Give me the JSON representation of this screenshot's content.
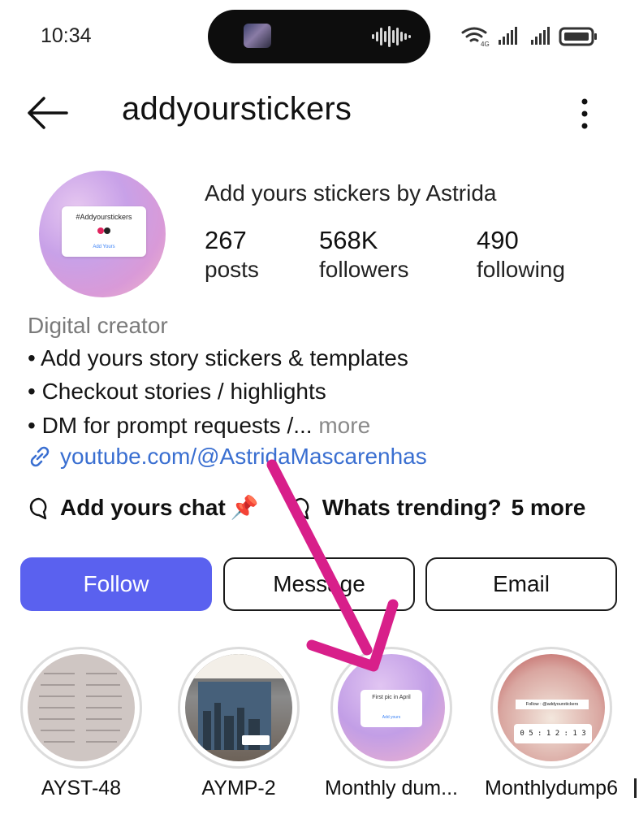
{
  "status_bar": {
    "time": "10:34"
  },
  "header": {
    "username": "addyourstickers"
  },
  "profile": {
    "display_name": "Add yours stickers by Astrida",
    "avatar_card_text": "#Addyourstickers",
    "avatar_card_button": "Add Yours",
    "stats": [
      {
        "value": "267",
        "label": "posts"
      },
      {
        "value": "568K",
        "label": "followers"
      },
      {
        "value": "490",
        "label": "following"
      }
    ],
    "category": "Digital creator",
    "bio": [
      "• Add yours story stickers & templates",
      "• Checkout stories / highlights",
      "• DM for prompt requests /..."
    ],
    "more_label": "more",
    "link": "youtube.com/@AstridaMascarenhas",
    "channels": [
      {
        "label": "Add yours chat",
        "emoji": "📌"
      },
      {
        "label": "Whats trending?"
      }
    ],
    "channels_more": "5 more"
  },
  "actions": {
    "follow": "Follow",
    "message": "Message",
    "email": "Email"
  },
  "highlights": [
    {
      "label": "AYST-48"
    },
    {
      "label": "AYMP-2"
    },
    {
      "label": "Monthly dum...",
      "card_text": "First pic in April",
      "card_button": "Add yours"
    },
    {
      "label": "Monthlydump6",
      "card_text": "Follow : @addyourstickers",
      "timer": "0 5 : 1 2 : 1 3"
    }
  ],
  "colors": {
    "follow_button": "#5a61ef",
    "link": "#3a6fd1",
    "annotation_arrow": "#d81f8a"
  }
}
